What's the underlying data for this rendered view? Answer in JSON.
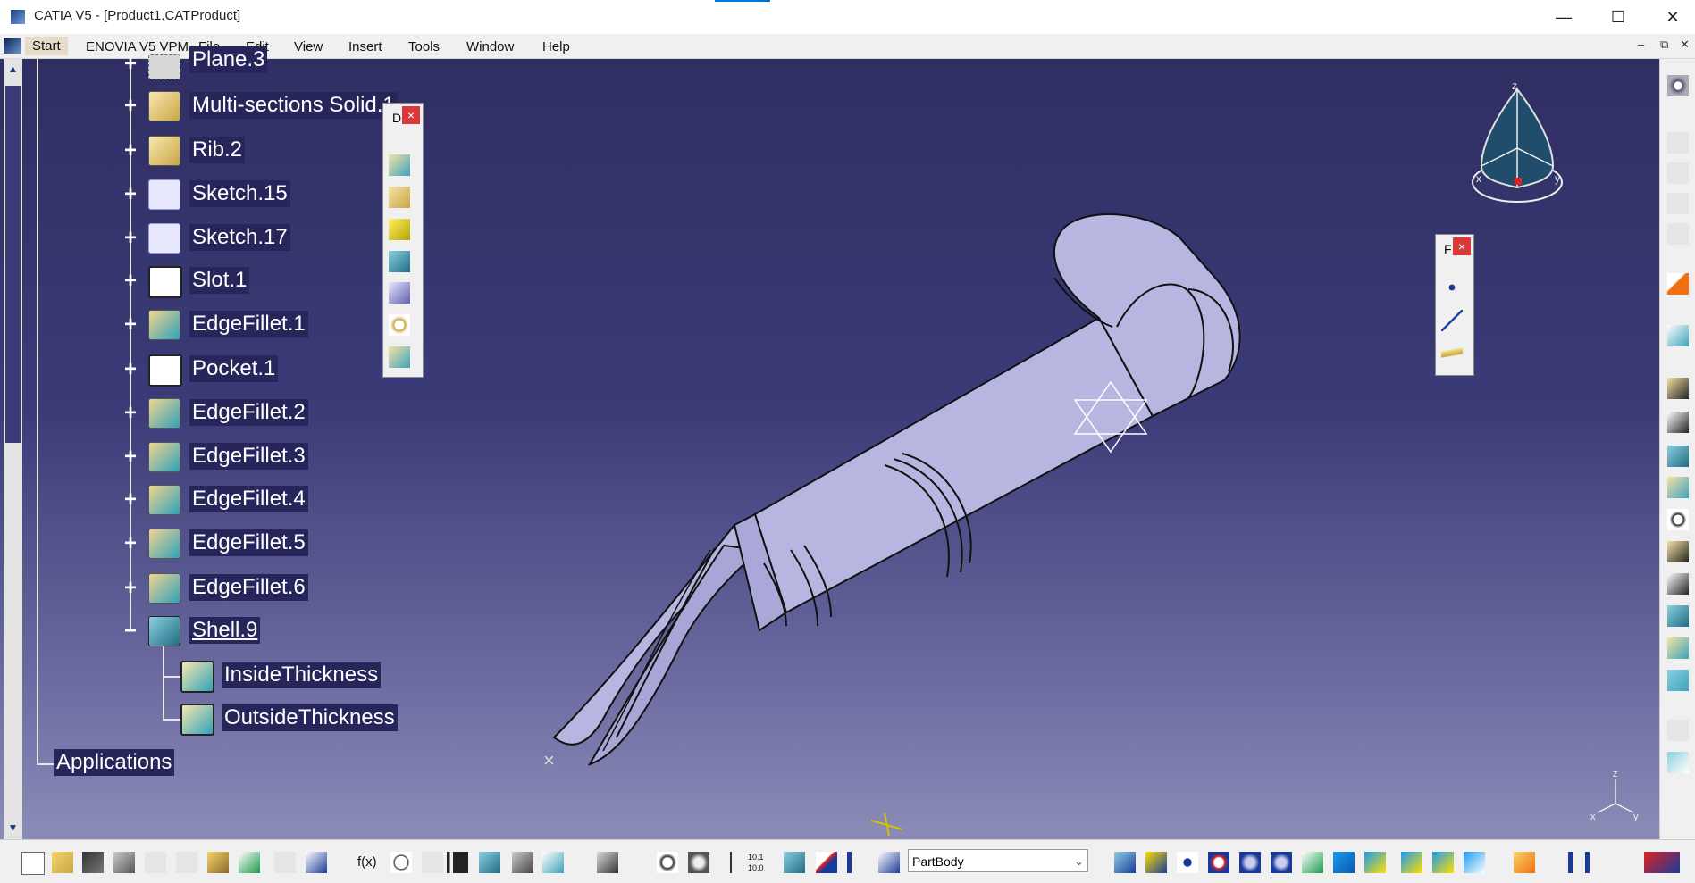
{
  "window": {
    "title": "CATIA V5 - [Product1.CATProduct]",
    "minimize_glyph": "—",
    "maximize_glyph": "☐",
    "close_glyph": "✕"
  },
  "menu": {
    "start": "Start",
    "enovia": "ENOVIA V5 VPM",
    "file": "File",
    "edit": "Edit",
    "view": "View",
    "insert": "Insert",
    "tools": "Tools",
    "window": "Window",
    "help": "Help",
    "mdi_min": "–",
    "mdi_restore": "⧉",
    "mdi_close": "✕"
  },
  "tree": {
    "nodes": [
      {
        "label": "Plane.3",
        "icon": "plane-icon"
      },
      {
        "label": "Multi-sections Solid.1",
        "icon": "multi-sections-solid-icon"
      },
      {
        "label": "Rib.2",
        "icon": "rib-icon"
      },
      {
        "label": "Sketch.15",
        "icon": "sketch-icon"
      },
      {
        "label": "Sketch.17",
        "icon": "sketch-icon"
      },
      {
        "label": "Slot.1",
        "icon": "slot-icon"
      },
      {
        "label": "EdgeFillet.1",
        "icon": "edge-fillet-icon"
      },
      {
        "label": "Pocket.1",
        "icon": "pocket-icon"
      },
      {
        "label": "EdgeFillet.2",
        "icon": "edge-fillet-icon"
      },
      {
        "label": "EdgeFillet.3",
        "icon": "edge-fillet-icon"
      },
      {
        "label": "EdgeFillet.4",
        "icon": "edge-fillet-icon"
      },
      {
        "label": "EdgeFillet.5",
        "icon": "edge-fillet-icon"
      },
      {
        "label": "EdgeFillet.6",
        "icon": "edge-fillet-icon"
      },
      {
        "label": "Shell.9",
        "icon": "shell-icon"
      }
    ],
    "children": [
      {
        "label": "InsideThickness",
        "icon": "thickness-icon"
      },
      {
        "label": "OutsideThickness",
        "icon": "thickness-icon"
      }
    ],
    "applications": "Applications",
    "expand_glyph": "+",
    "collapse_glyph": "−"
  },
  "floating_toolbars": {
    "dress_up_title": "D",
    "point_title": "F",
    "close_glyph": "×"
  },
  "compass": {
    "z": "z",
    "x": "x",
    "y": "y"
  },
  "axis_triad": {
    "z": "z",
    "x": "x",
    "y": "y"
  },
  "statusbar": {
    "fx": "f(x)",
    "scale": "10.1 10.0",
    "partbody_select": "PartBody",
    "dropdown_glyph": "⌄"
  },
  "colors": {
    "viewport_top": "#2f2f63",
    "viewport_bottom": "#8c8cb8",
    "tree_label_bg": "#26265a",
    "part_fill": "#b7b6e0",
    "close_red": "#d9393a"
  }
}
